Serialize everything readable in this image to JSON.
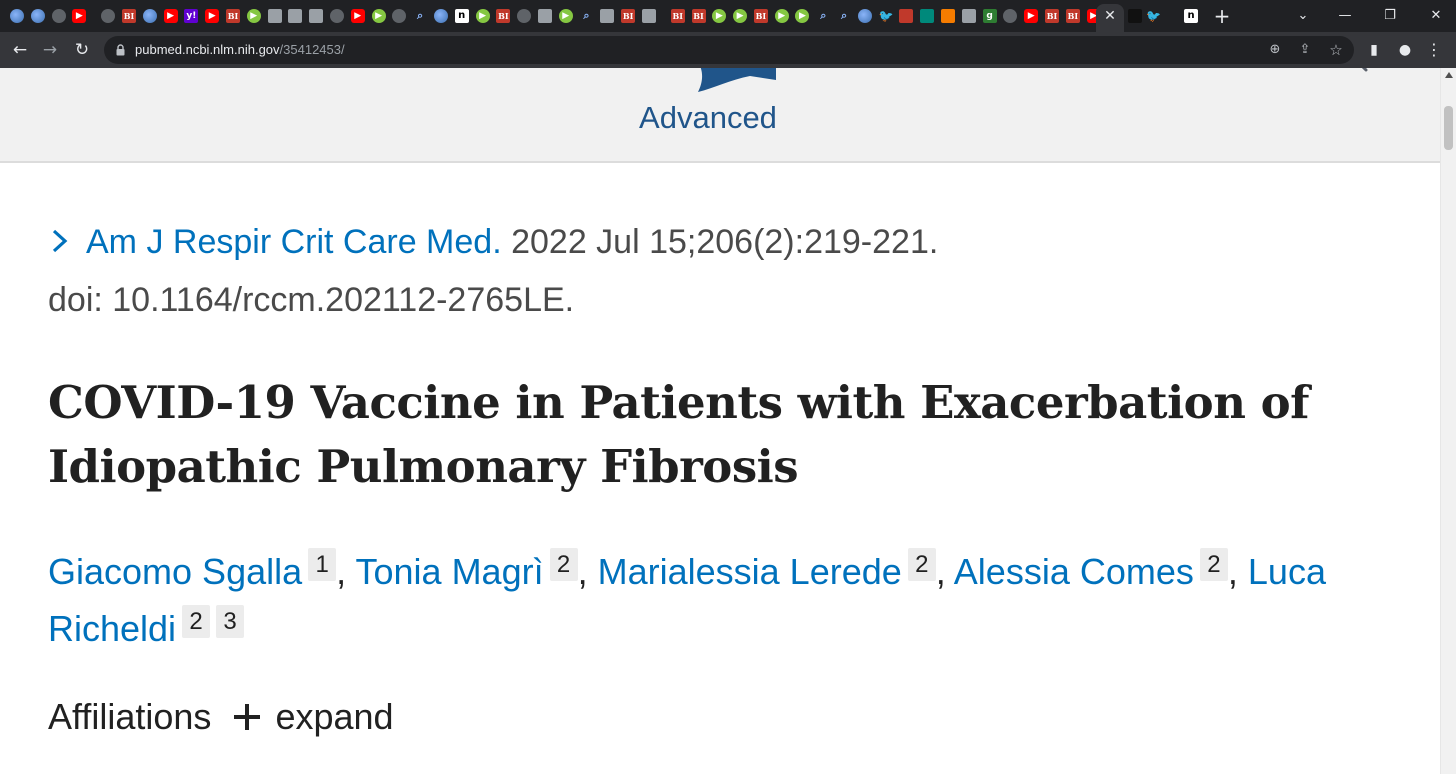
{
  "browser": {
    "tab_favicons": [
      "globe",
      "globe",
      "blank",
      "youtube",
      "gap",
      "blank",
      "business-insider",
      "globe",
      "youtube",
      "yahoo",
      "youtube",
      "business-insider",
      "rumble",
      "gray",
      "gray",
      "gray",
      "blank",
      "youtube",
      "rumble",
      "blank",
      "search",
      "globe",
      "n",
      "rumble",
      "business-insider",
      "blank",
      "gray",
      "rumble",
      "search",
      "gray",
      "business-insider",
      "gray",
      "gap",
      "business-insider",
      "business-insider",
      "rumble",
      "rumble",
      "business-insider",
      "rumble",
      "rumble",
      "search",
      "search",
      "globe",
      "twitter",
      "red",
      "teal",
      "orange",
      "gray",
      "green",
      "blank",
      "youtube",
      "business-insider",
      "business-insider",
      "youtube"
    ],
    "active_tab_close": "✕",
    "tail_favicons": [
      "p-black",
      "twitter",
      "gap",
      "n-white"
    ],
    "new_tab": "+",
    "window_controls": {
      "tab_search": "⌄",
      "minimize": "—",
      "restore": "❐",
      "close": "✕"
    },
    "nav": {
      "back": "←",
      "forward": "→",
      "reload": "↻"
    },
    "url_host": "pubmed.ncbi.nlm.nih.gov",
    "url_path": "/35412453/",
    "address_icons": {
      "zoom": "⊕",
      "share": "⇪",
      "bookmark": "☆"
    },
    "toolbar_icons": {
      "side_panel": "▮",
      "profile": "●",
      "menu": "⋮"
    }
  },
  "header": {
    "advanced_label": "Advanced",
    "brand_color": "#20558a"
  },
  "citation": {
    "journal": "Am J Respir Crit Care Med.",
    "date_volume": " 2022 Jul 15;206(2):219-221.",
    "doi": "doi: 10.1164/rccm.202112-2765LE."
  },
  "article": {
    "title": "COVID-19 Vaccine in Patients with Exacerbation of Idiopathic Pulmonary Fibrosis"
  },
  "authors": [
    {
      "name": "Giacomo Sgalla",
      "affiliations": [
        "1"
      ]
    },
    {
      "name": "Tonia Magrì",
      "affiliations": [
        "2"
      ]
    },
    {
      "name": "Marialessia Lerede",
      "affiliations": [
        "2"
      ]
    },
    {
      "name": "Alessia Comes",
      "affiliations": [
        "2"
      ]
    },
    {
      "name": "Luca Richeldi",
      "affiliations": [
        "2",
        "3"
      ]
    }
  ],
  "affiliations": {
    "label": "Affiliations",
    "expand_label": "expand"
  },
  "colors": {
    "link": "#0071bc",
    "text": "#212121",
    "chrome_dark": "#202124",
    "chrome_toolbar": "#35363a"
  }
}
